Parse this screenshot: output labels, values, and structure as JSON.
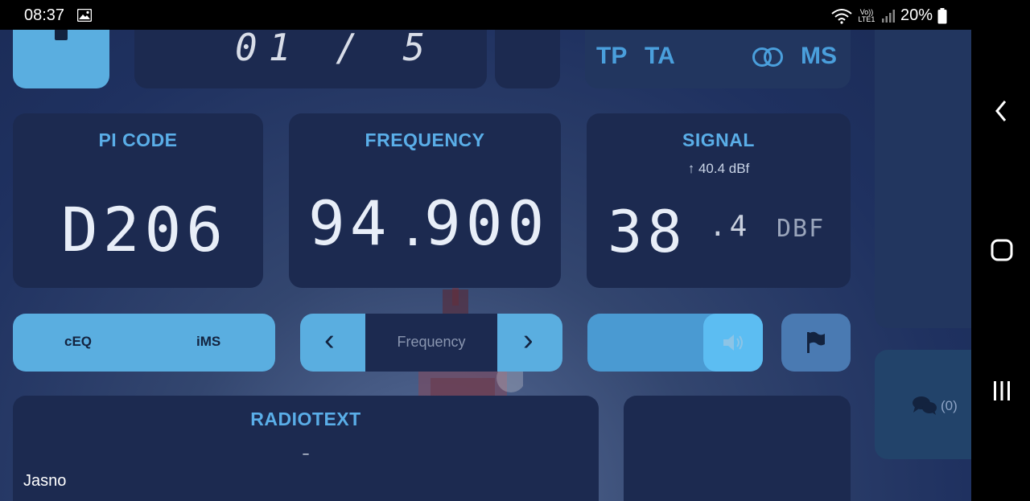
{
  "status_bar": {
    "time": "08:37",
    "network": "Vo)) LTE1",
    "battery": "20%"
  },
  "top_row": {
    "ps_fragment": "01 / 5",
    "tp": "TP",
    "ta": "TA",
    "ms": "MS"
  },
  "pi_code": {
    "title": "PI CODE",
    "value": "D206"
  },
  "frequency": {
    "title": "FREQUENCY",
    "integer": "94",
    "dot": ".",
    "fraction": "900"
  },
  "signal": {
    "title": "SIGNAL",
    "peak": "40.4 dBf",
    "integer": "38",
    "fraction": ".4",
    "unit": "DBF"
  },
  "controls": {
    "ceq": "cEQ",
    "ims": "iMS",
    "freq_placeholder": "Frequency",
    "prev": "‹",
    "next": "›"
  },
  "radiotext": {
    "title": "RADIOTEXT",
    "value": "–"
  },
  "weather_text": "Jasno",
  "chat": {
    "count": "(0)"
  },
  "colors": {
    "accent": "#5aaee8",
    "panel": "#1c2a50",
    "button": "#5aaee0"
  }
}
